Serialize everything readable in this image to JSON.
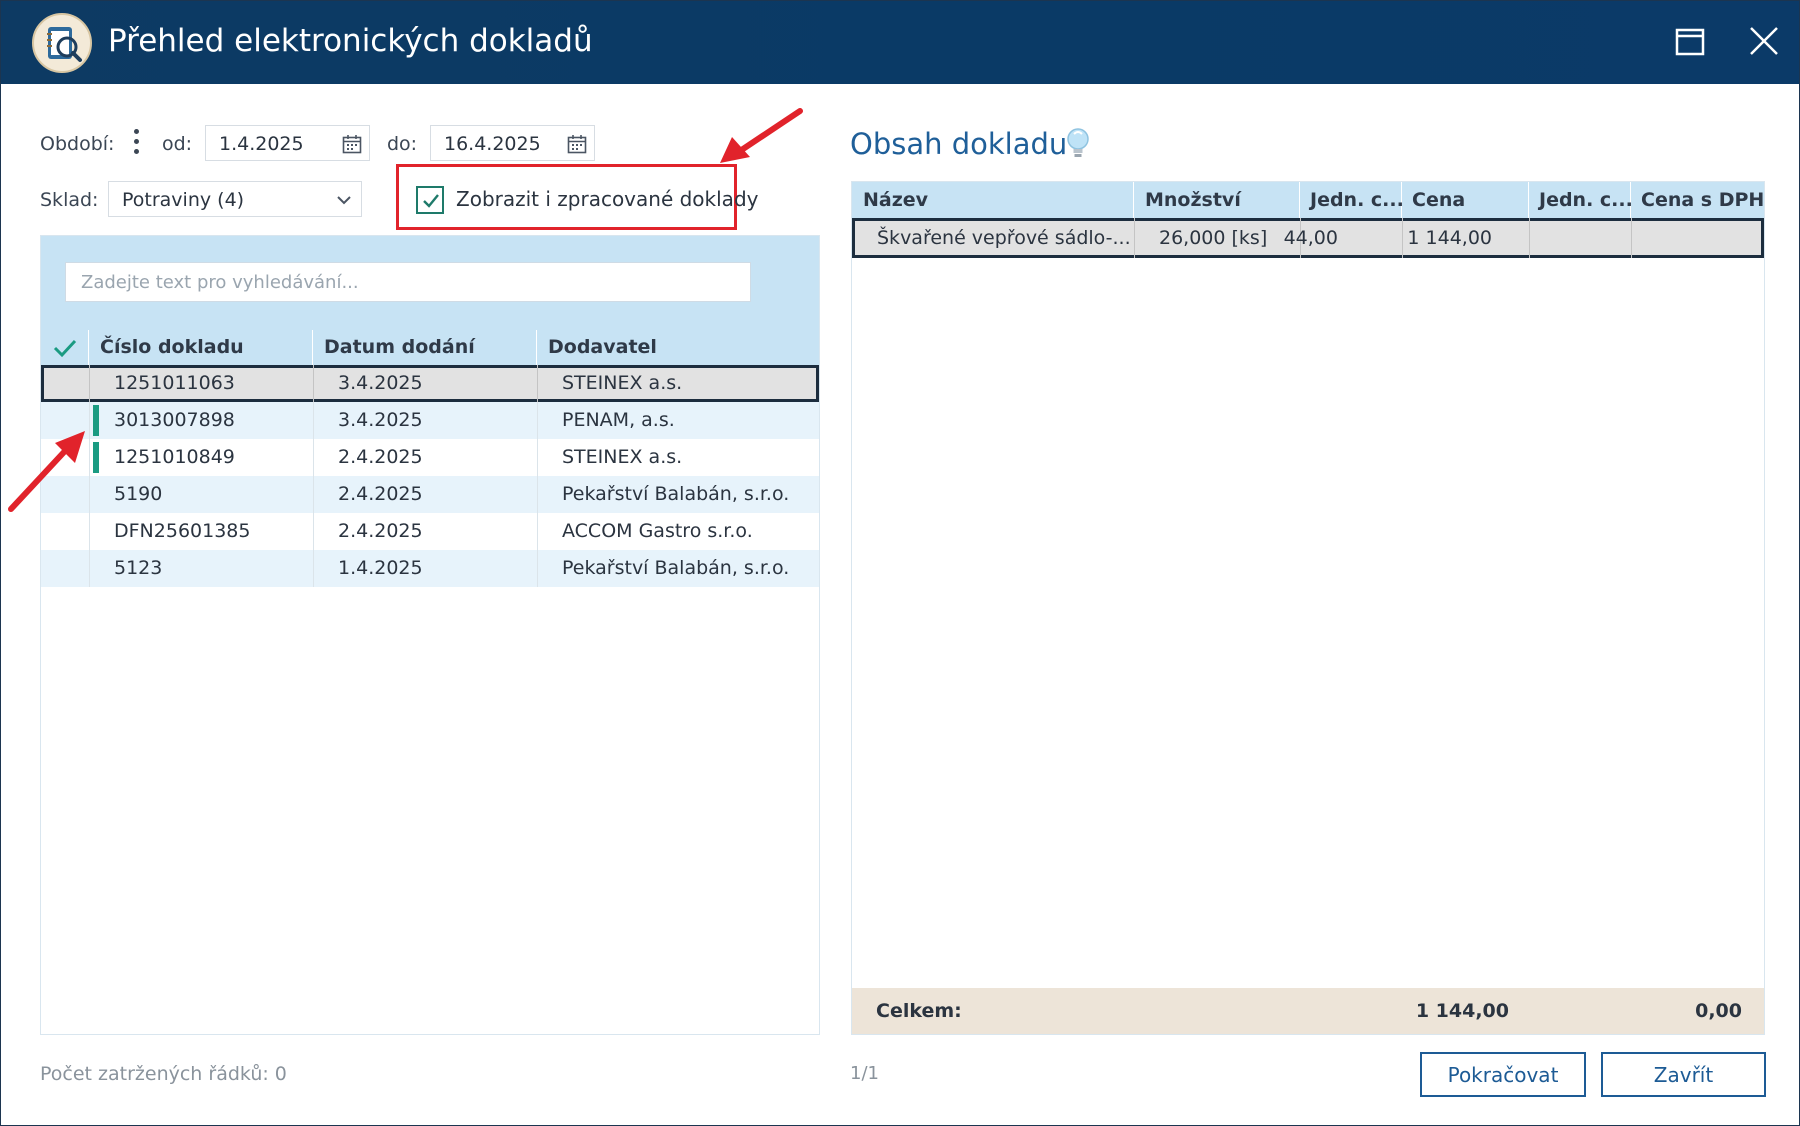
{
  "window": {
    "title": "Přehled elektronických dokladů",
    "icons": {
      "app": "document-search-icon",
      "maximize": "maximize-icon",
      "close": "close-icon"
    }
  },
  "filters": {
    "period_label": "Období:",
    "from_label": "od:",
    "from_value": "1.4.2025",
    "to_label": "do:",
    "to_value": "16.4.2025",
    "warehouse_label": "Sklad:",
    "warehouse_value": "Potraviny (4)",
    "show_processed_label": "Zobrazit i zpracované doklady",
    "show_processed_checked": true
  },
  "search": {
    "placeholder": "Zadejte text pro vyhledávání..."
  },
  "documents": {
    "columns": [
      "Číslo dokladu",
      "Datum dodání",
      "Dodavatel"
    ],
    "rows": [
      {
        "number": "1251011063",
        "date": "3.4.2025",
        "supplier": "STEINEX a.s.",
        "selected": true,
        "processed": false
      },
      {
        "number": "3013007898",
        "date": "3.4.2025",
        "supplier": "PENAM, a.s.",
        "selected": false,
        "processed": true
      },
      {
        "number": "1251010849",
        "date": "2.4.2025",
        "supplier": "STEINEX a.s.",
        "selected": false,
        "processed": true
      },
      {
        "number": "5190",
        "date": "2.4.2025",
        "supplier": "Pekařství Balabán, s.r.o.",
        "selected": false,
        "processed": false
      },
      {
        "number": "DFN25601385",
        "date": "2.4.2025",
        "supplier": "ACCOM Gastro s.r.o.",
        "selected": false,
        "processed": false
      },
      {
        "number": "5123",
        "date": "1.4.2025",
        "supplier": "Pekařství Balabán, s.r.o.",
        "selected": false,
        "processed": false
      }
    ],
    "checked_count_label": "Počet zatržených řádků: 0"
  },
  "detail": {
    "title": "Obsah dokladu",
    "columns": [
      "Název",
      "Množství",
      "Jedn. c...",
      "Cena",
      "Jedn. c...",
      "Cena s DPH"
    ],
    "rows": [
      {
        "name": "Škvařené vepřové sádlo-...",
        "quantity": "26,000 [ks]",
        "unit_price": "44,00",
        "price": "1 144,00",
        "unit_price_vat": "",
        "price_vat": ""
      }
    ],
    "totals": {
      "label": "Celkem:",
      "price": "1 144,00",
      "price_vat": "0,00"
    },
    "pager": "1/1"
  },
  "buttons": {
    "continue": "Pokračovat",
    "close": "Zavřít"
  },
  "colors": {
    "titlebar": "#0b3a66",
    "header_band": "#c7e3f4",
    "processed_marker": "#1a9b82",
    "annotation": "#e1232b",
    "accent": "#1d5b95"
  }
}
